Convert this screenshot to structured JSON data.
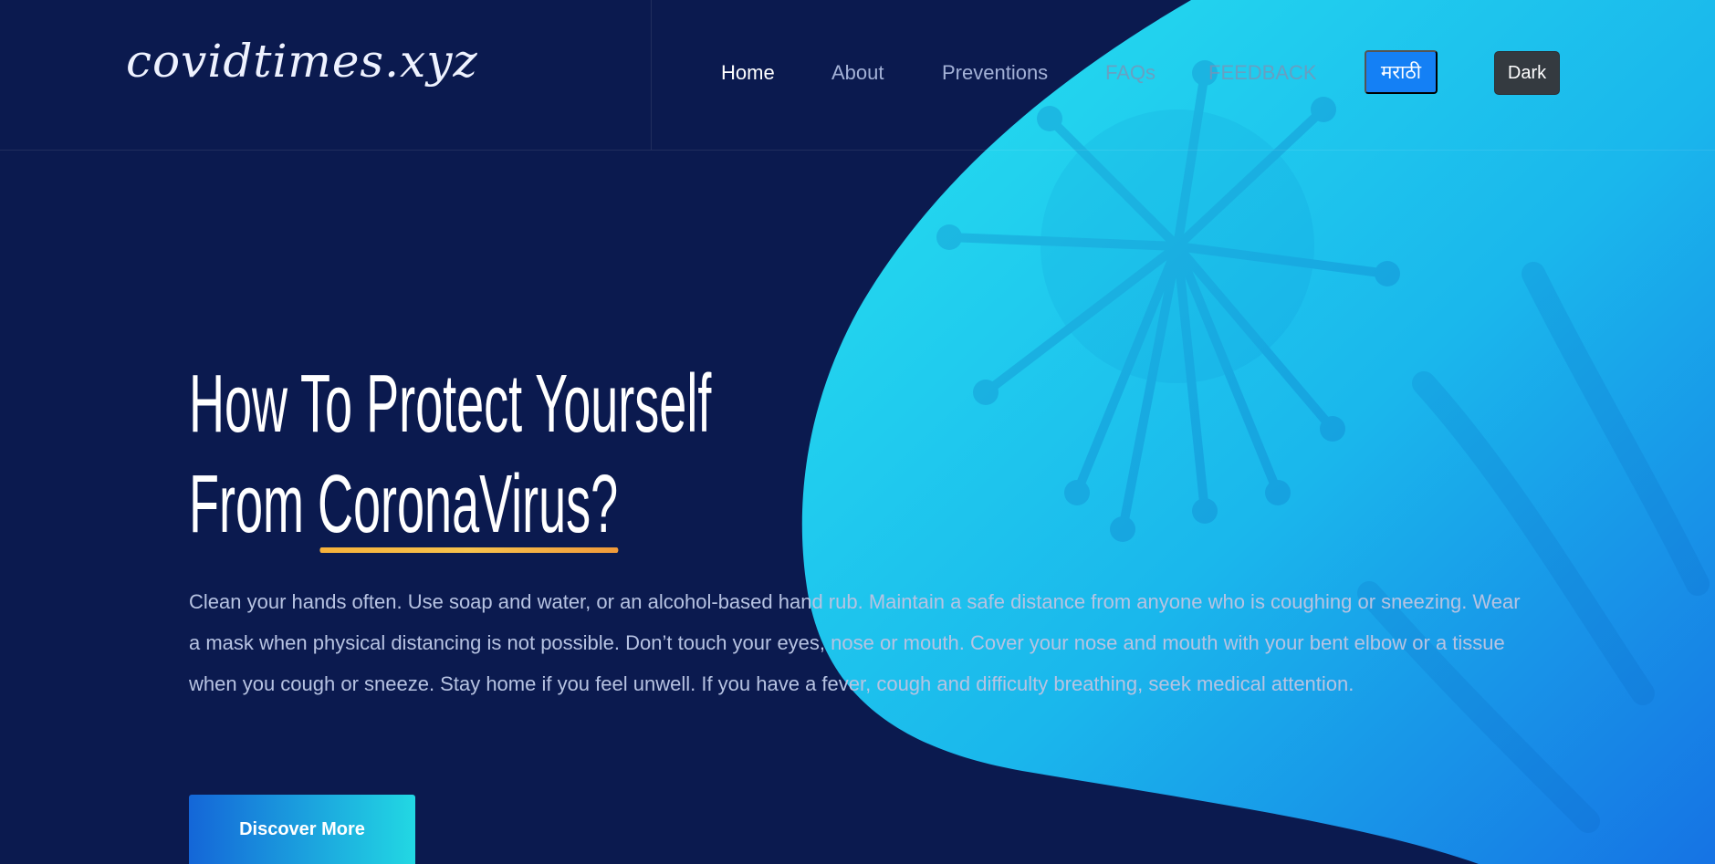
{
  "header": {
    "logo": "covidtimes.xyz",
    "nav": {
      "home": "Home",
      "about": "About",
      "preventions": "Preventions",
      "faqs": "FAQs",
      "feedback": "FEEDBACK"
    },
    "lang_button": "मराठी",
    "theme_button": "Dark"
  },
  "hero": {
    "title_line1": "How To Protect Yourself",
    "title_line2_prefix": "From ",
    "title_line2_highlight": "CoronaVirus?",
    "description": "Clean your hands often. Use soap and water, or an alcohol-based hand rub. Maintain a safe distance from anyone who is coughing or sneezing. Wear a mask when physical distancing is not possible. Don’t touch your eyes, nose or mouth. Cover your nose and mouth with your bent elbow or a tissue when you cough or sneeze. Stay home if you feel unwell. If you have a fever, cough and difficulty breathing, seek medical attention.",
    "cta": "Discover More"
  },
  "colors": {
    "background": "#0b1a4f",
    "blob_light": "#24d9ee",
    "blob_dark": "#1678e6",
    "accent_underline": "#f7b23b",
    "lang_button": "#1480f5",
    "theme_button": "#343a40"
  },
  "icons": {
    "hero_image": "virus-illustration"
  }
}
